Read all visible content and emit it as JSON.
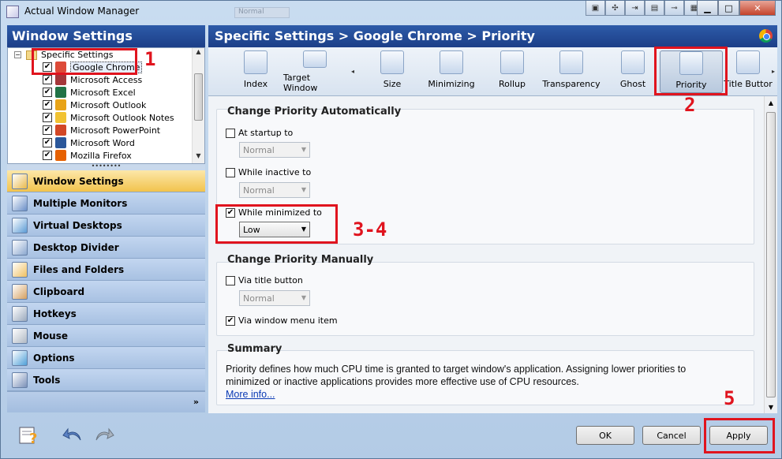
{
  "window": {
    "title": "Actual Window Manager",
    "ghost_field": "Normal",
    "title_buttons": [
      "pin-icon",
      "move-icon",
      "minimize-to-tray-icon",
      "ghost-icon",
      "stay-on-top-icon",
      "transparency-icon"
    ]
  },
  "left": {
    "header": "Window Settings",
    "tree": {
      "root": "Specific Settings",
      "items": [
        {
          "label": "Google Chrome",
          "color": "#dd4b39",
          "checked": true,
          "selected": true
        },
        {
          "label": "Microsoft Access",
          "color": "#a4373a",
          "checked": true
        },
        {
          "label": "Microsoft Excel",
          "color": "#217346",
          "checked": true
        },
        {
          "label": "Microsoft Outlook",
          "color": "#e8a317",
          "checked": true
        },
        {
          "label": "Microsoft Outlook Notes",
          "color": "#f1c232",
          "checked": true
        },
        {
          "label": "Microsoft PowerPoint",
          "color": "#d24726",
          "checked": true
        },
        {
          "label": "Microsoft Word",
          "color": "#2b579a",
          "checked": true
        },
        {
          "label": "Mozilla Firefox",
          "color": "#e66000",
          "checked": true
        }
      ]
    },
    "nav": [
      {
        "label": "Window Settings",
        "icon": "window-settings-icon",
        "active": true
      },
      {
        "label": "Multiple Monitors",
        "icon": "monitors-icon"
      },
      {
        "label": "Virtual Desktops",
        "icon": "virtual-desktops-icon"
      },
      {
        "label": "Desktop Divider",
        "icon": "desktop-divider-icon"
      },
      {
        "label": "Files and Folders",
        "icon": "folders-icon"
      },
      {
        "label": "Clipboard",
        "icon": "clipboard-icon"
      },
      {
        "label": "Hotkeys",
        "icon": "keyboard-icon"
      },
      {
        "label": "Mouse",
        "icon": "mouse-icon"
      },
      {
        "label": "Options",
        "icon": "options-icon"
      },
      {
        "label": "Tools",
        "icon": "tools-icon"
      }
    ],
    "footer_chevron": "»"
  },
  "right": {
    "header": "Specific Settings > Google Chrome > Priority",
    "toolbar": [
      {
        "label": "Index",
        "icon": "index-icon"
      },
      {
        "label": "Target Window",
        "icon": "target-window-icon"
      },
      {
        "label": "Size",
        "icon": "size-icon"
      },
      {
        "label": "Minimizing",
        "icon": "minimizing-icon"
      },
      {
        "label": "Rollup",
        "icon": "rollup-icon"
      },
      {
        "label": "Transparency",
        "icon": "transparency-icon"
      },
      {
        "label": "Ghost",
        "icon": "ghost-icon"
      },
      {
        "label": "Priority",
        "icon": "priority-clock-icon",
        "active": true
      },
      {
        "label": "Title Buttor",
        "icon": "title-buttons-icon"
      }
    ],
    "auto": {
      "title": "Change Priority Automatically",
      "startup": {
        "label": "At startup to",
        "checked": false,
        "value": "Normal"
      },
      "inactive": {
        "label": "While inactive to",
        "checked": false,
        "value": "Normal"
      },
      "minimized": {
        "label": "While minimized to",
        "checked": true,
        "value": "Low"
      }
    },
    "manual": {
      "title": "Change Priority Manually",
      "title_button": {
        "label": "Via title button",
        "checked": false,
        "value": "Normal"
      },
      "window_menu": {
        "label": "Via window menu item",
        "checked": true
      }
    },
    "summary": {
      "title": "Summary",
      "text": "Priority defines how much CPU time is granted to target window's application. Assigning lower priorities to minimized or inactive applications provides more effective use of CPU resources.",
      "link": "More info..."
    }
  },
  "buttons": {
    "ok": "OK",
    "cancel": "Cancel",
    "apply": "Apply"
  },
  "annotations": {
    "m1": "1",
    "m2": "2",
    "m34": "3-4",
    "m5": "5"
  }
}
